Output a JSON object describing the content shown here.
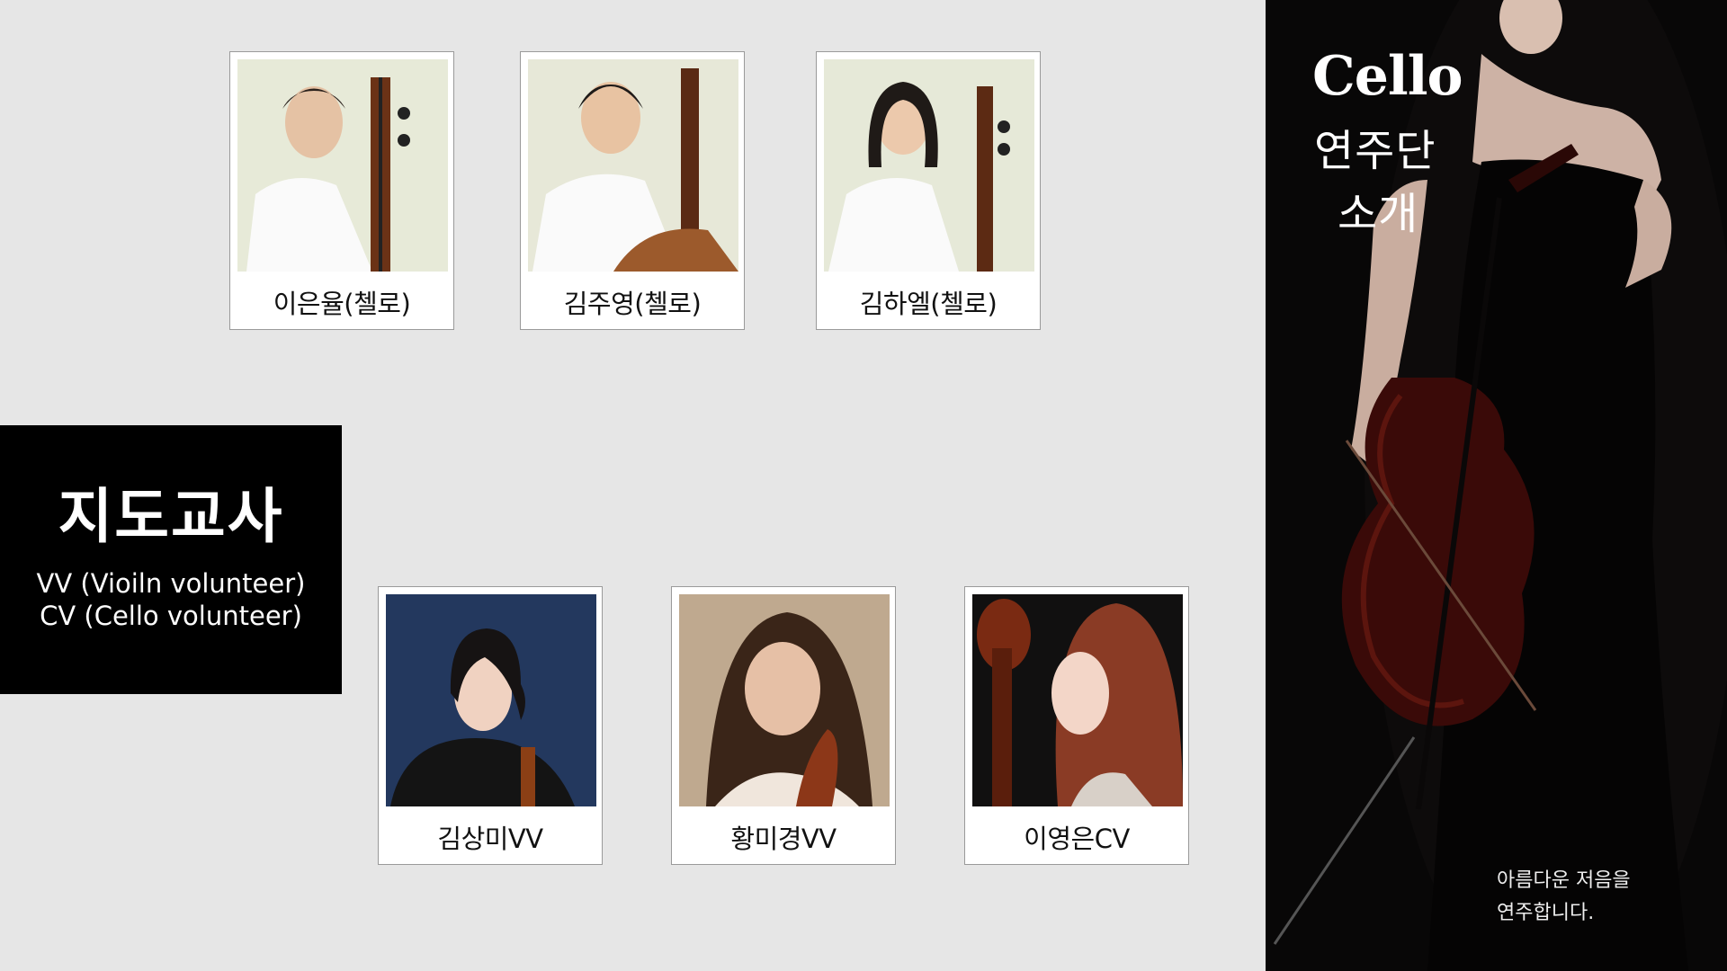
{
  "students": [
    {
      "name": "이은율(첼로)"
    },
    {
      "name": "김주영(첼로)"
    },
    {
      "name": "김하엘(첼로)"
    }
  ],
  "teachers_section": {
    "title": "지도교사",
    "legend_line1": "VV (Vioiln volunteer)",
    "legend_line2": "CV (Cello volunteer)"
  },
  "teachers": [
    {
      "name": "김상미VV"
    },
    {
      "name": "황미경VV"
    },
    {
      "name": "이영은CV"
    }
  ],
  "poster": {
    "title_en": "Cello",
    "title_ko_line1": "연주단",
    "title_ko_line2": "소개",
    "tagline_line1": "아름다운 저음을",
    "tagline_line2": "연주합니다."
  },
  "colors": {
    "page_bg": "#e6e6e6",
    "panel_bg": "#000000",
    "text_light": "#ffffff"
  }
}
